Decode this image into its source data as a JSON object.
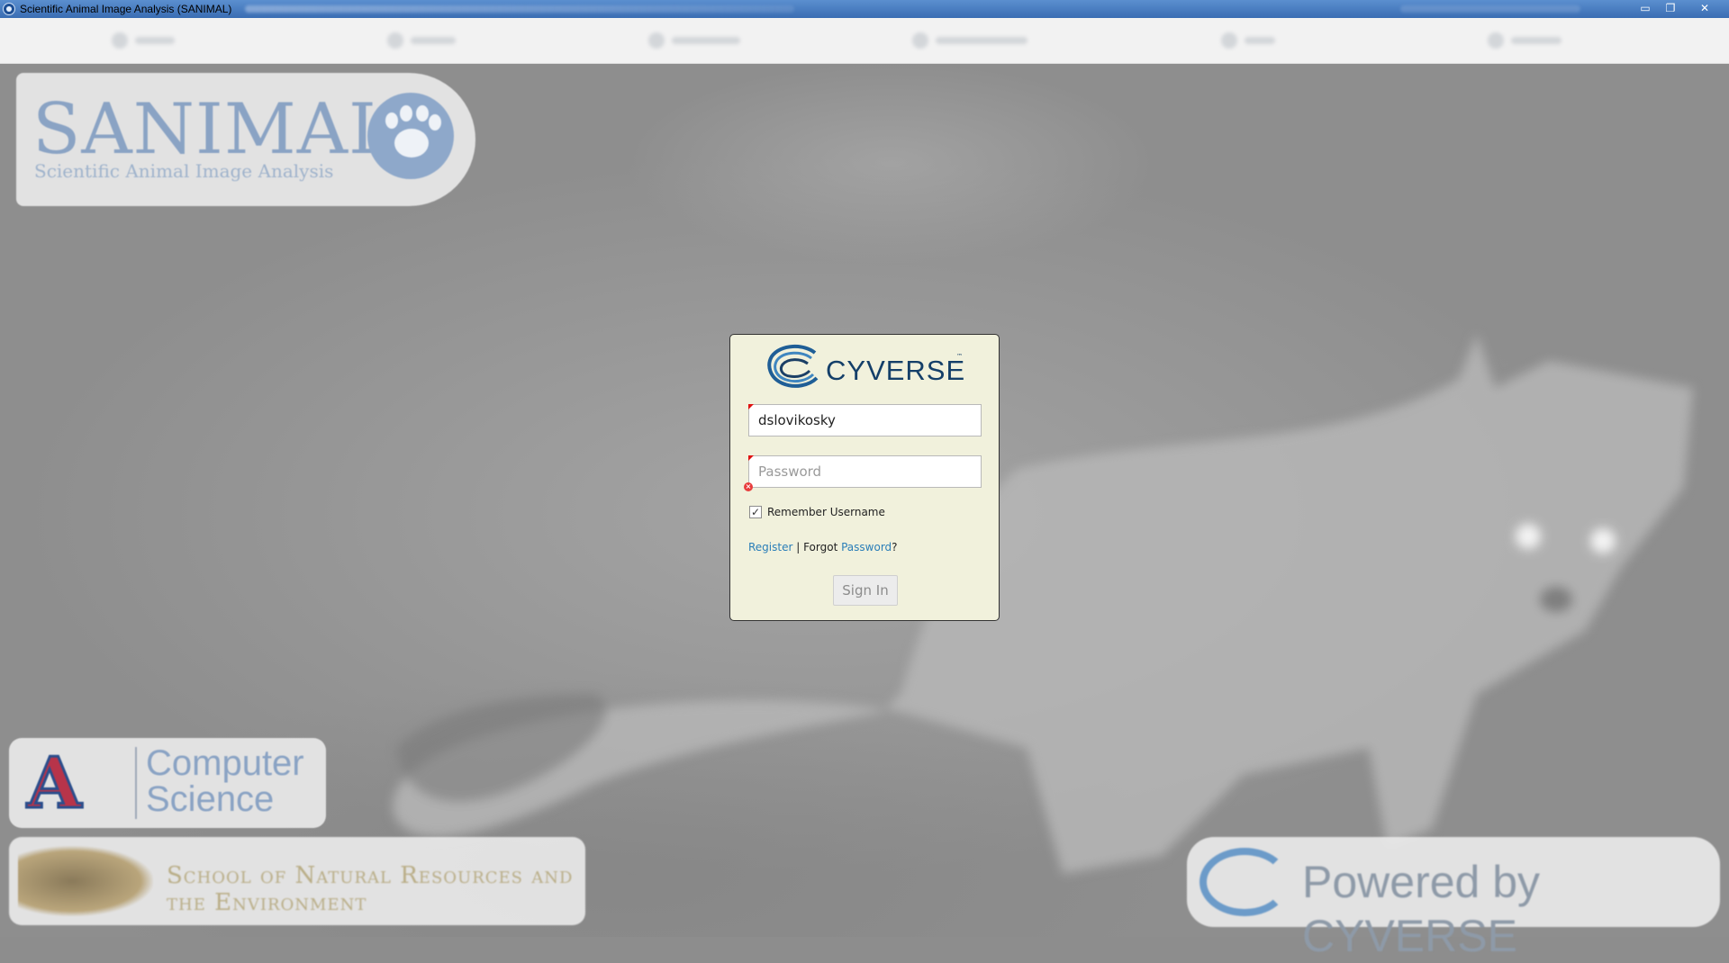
{
  "window": {
    "title": "Scientific Animal Image Analysis (SANIMAL)",
    "controls": {
      "minimize": "▭",
      "restore": "❐",
      "close": "✕"
    }
  },
  "logos": {
    "sanimal_word": "SANIMAL",
    "sanimal_sub": "Scientific Animal Image Analysis",
    "ua_letter": "A",
    "ua_line1": "Computer",
    "ua_line2": "Science",
    "snre_text": "School of Natural Resources and the Environment",
    "powered_text": "Powered by CYVERSE"
  },
  "login": {
    "brand": "CYVERSE",
    "brand_tm": "™",
    "username_value": "dslovikosky",
    "password_placeholder": "Password",
    "remember_label": "Remember Username",
    "remember_checked": "✓",
    "register_label": "Register",
    "separator": " | Forgot ",
    "password_link": "Password",
    "question": "?",
    "signin_label": "Sign In"
  },
  "colors": {
    "dialog_bg": "#f1f1dc",
    "link": "#2a7eb8",
    "brand_navy": "#143f69",
    "error_red": "#e01010"
  }
}
